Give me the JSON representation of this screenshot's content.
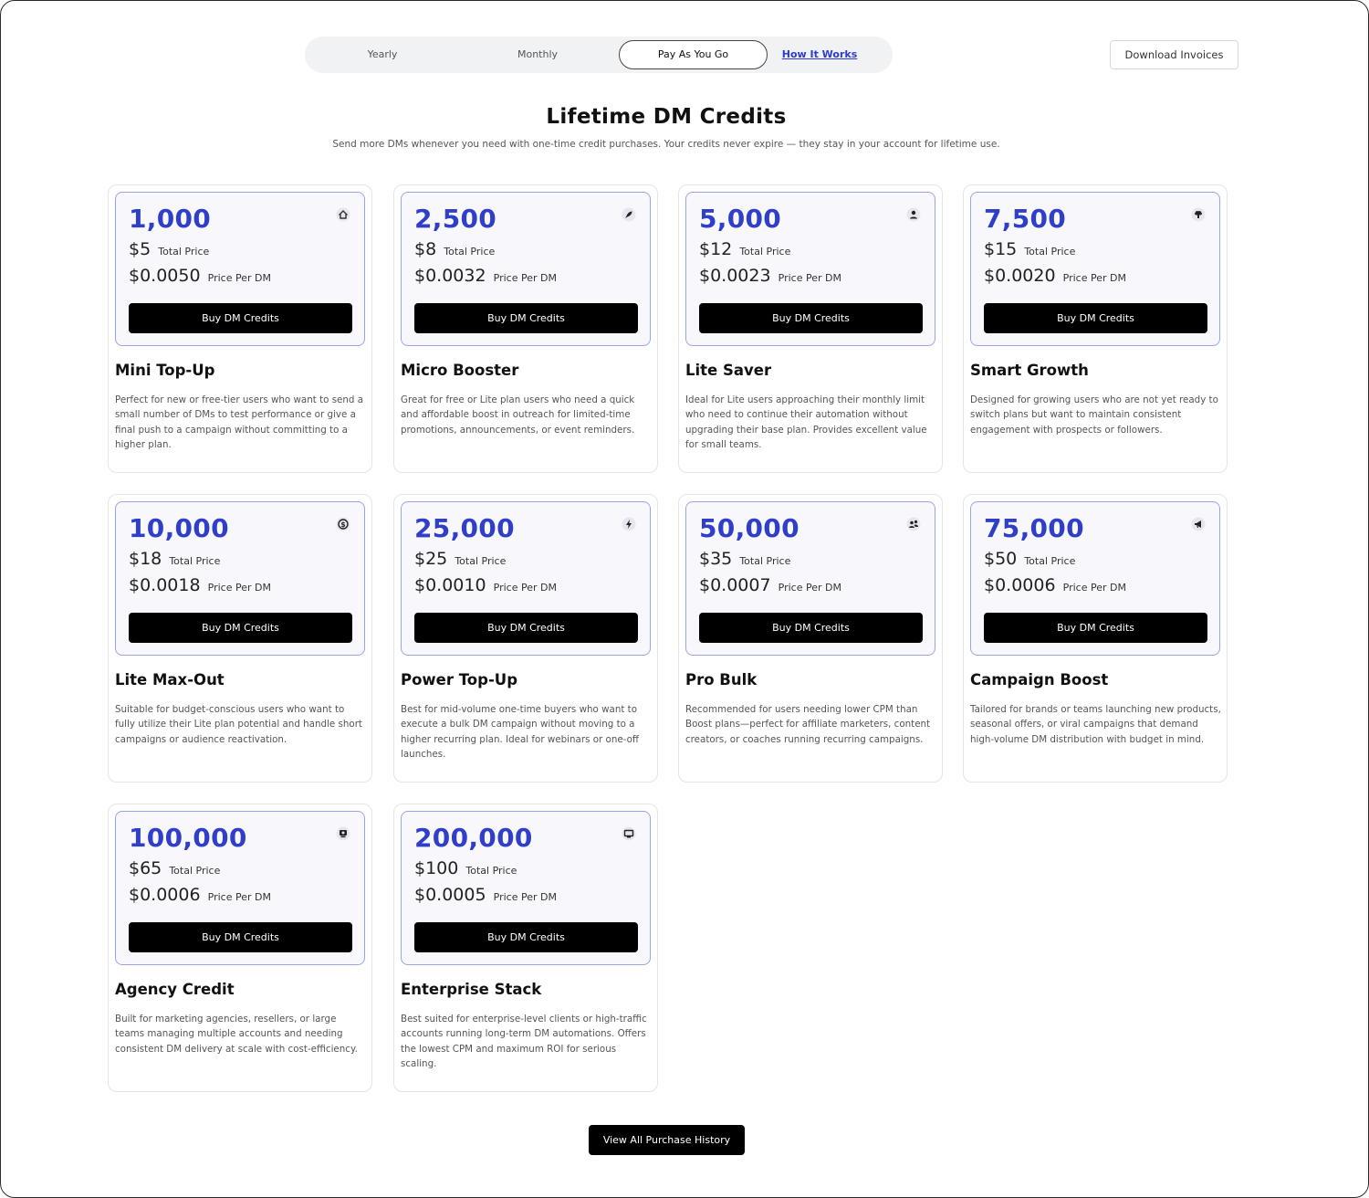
{
  "tabs": [
    {
      "label": "Yearly"
    },
    {
      "label": "Monthly"
    },
    {
      "label": "Pay As You Go"
    },
    {
      "label": "How It Works"
    }
  ],
  "download_label": "Download Invoices",
  "title": "Lifetime DM Credits",
  "subtitle": "Send more DMs whenever you need with one-time credit purchases. Your credits never expire — they stay in your account for lifetime use.",
  "total_price_label": "Total Price",
  "price_per_dm_label": "Price Per DM",
  "buy_label": "Buy DM Credits",
  "history_label": "View All Purchase History",
  "accent_color": "#2f3fc9",
  "plans": [
    {
      "credits": "1,000",
      "total": "$5",
      "per_dm": "$0.0050",
      "name": "Mini Top-Up",
      "icon": "home-icon",
      "desc": "Perfect for new or free-tier users who want to send a small number of DMs to test performance or give a final push to a campaign without committing to a higher plan."
    },
    {
      "credits": "2,500",
      "total": "$8",
      "per_dm": "$0.0032",
      "name": "Micro Booster",
      "icon": "rocket-icon",
      "desc": "Great for free or Lite plan users who need a quick and affordable boost in outreach for limited-time promotions, announcements, or event reminders."
    },
    {
      "credits": "5,000",
      "total": "$12",
      "per_dm": "$0.0023",
      "name": "Lite Saver",
      "icon": "user-badge-icon",
      "desc": "Ideal for Lite users approaching their monthly limit who need to continue their automation without upgrading their base plan. Provides excellent value for small teams."
    },
    {
      "credits": "7,500",
      "total": "$15",
      "per_dm": "$0.0020",
      "name": "Smart Growth",
      "icon": "brain-icon",
      "desc": "Designed for growing users who are not yet ready to switch plans but want to maintain consistent engagement with prospects or followers."
    },
    {
      "credits": "10,000",
      "total": "$18",
      "per_dm": "$0.0018",
      "name": "Lite Max-Out",
      "icon": "dollar-circle-icon",
      "desc": "Suitable for budget-conscious users who want to fully utilize their Lite plan potential and handle short campaigns or audience reactivation."
    },
    {
      "credits": "25,000",
      "total": "$25",
      "per_dm": "$0.0010",
      "name": "Power Top-Up",
      "icon": "lightning-icon",
      "desc": "Best for mid-volume one-time buyers who want to execute a bulk DM campaign without moving to a higher recurring plan. Ideal for webinars or one-off launches."
    },
    {
      "credits": "50,000",
      "total": "$35",
      "per_dm": "$0.0007",
      "name": "Pro Bulk",
      "icon": "users-icon",
      "desc": "Recommended for users needing lower CPM than Boost plans—perfect for affiliate marketers, content creators, or coaches running recurring campaigns."
    },
    {
      "credits": "75,000",
      "total": "$50",
      "per_dm": "$0.0006",
      "name": "Campaign Boost",
      "icon": "megaphone-icon",
      "desc": "Tailored for brands or teams launching new products, seasonal offers, or viral campaigns that demand high-volume DM distribution with budget in mind."
    },
    {
      "credits": "100,000",
      "total": "$65",
      "per_dm": "$0.0006",
      "name": "Agency Credit",
      "icon": "agency-icon",
      "desc": "Built for marketing agencies, resellers, or large teams managing multiple accounts and needing consistent DM delivery at scale with cost-efficiency."
    },
    {
      "credits": "200,000",
      "total": "$100",
      "per_dm": "$0.0005",
      "name": "Enterprise Stack",
      "icon": "monitor-icon",
      "desc": "Best suited for enterprise-level clients or high-traffic accounts running long-term DM automations. Offers the lowest CPM and maximum ROI for serious scaling."
    }
  ]
}
